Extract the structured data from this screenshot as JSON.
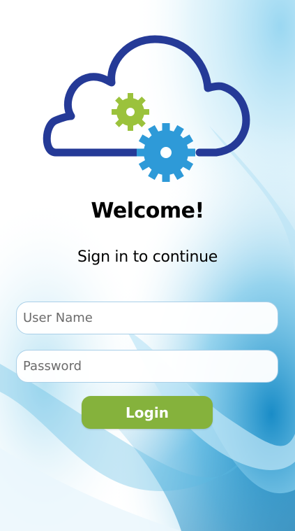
{
  "header": {
    "title": "Welcome!",
    "subtitle": "Sign in to continue"
  },
  "logo": {
    "icon": "cloud-gears-icon",
    "cloud_color": "#253a97",
    "small_gear_color": "#9bc23c",
    "large_gear_color": "#2e9ad8"
  },
  "form": {
    "username": {
      "placeholder": "User Name",
      "value": ""
    },
    "password": {
      "placeholder": "Password",
      "value": ""
    },
    "login_label": "Login"
  },
  "colors": {
    "accent": "#85b23c",
    "field_border": "#a9cfe8",
    "background_tint": "#2d9ccd"
  }
}
